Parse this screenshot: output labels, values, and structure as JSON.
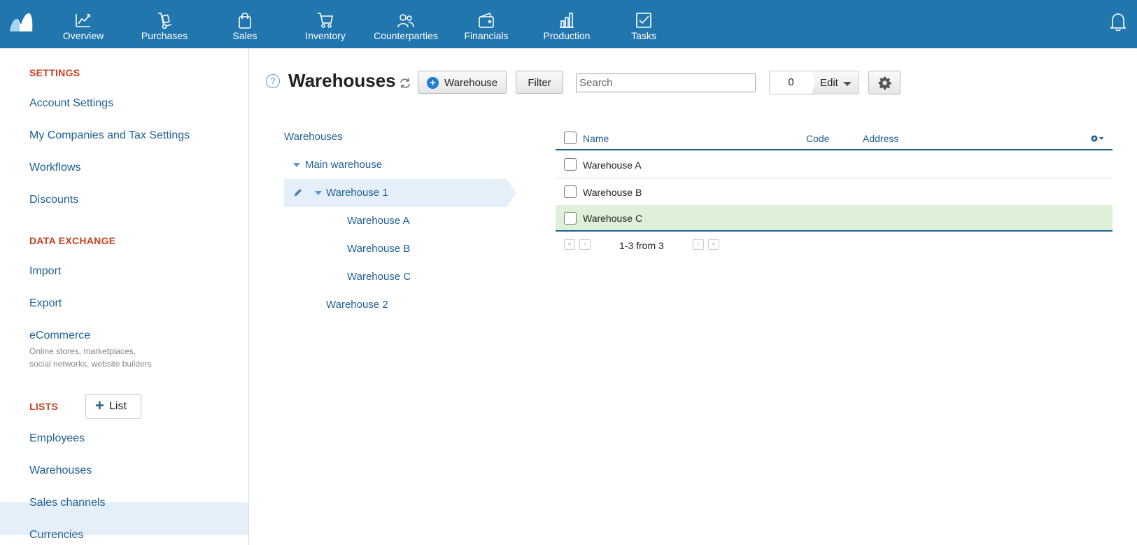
{
  "topnav": {
    "items": [
      {
        "label": "Overview",
        "icon": "chart-line-icon"
      },
      {
        "label": "Purchases",
        "icon": "hand-truck-icon"
      },
      {
        "label": "Sales",
        "icon": "shopping-bag-icon"
      },
      {
        "label": "Inventory",
        "icon": "cart-icon"
      },
      {
        "label": "Counterparties",
        "icon": "people-icon"
      },
      {
        "label": "Financials",
        "icon": "wallet-icon"
      },
      {
        "label": "Production",
        "icon": "factory-icon"
      },
      {
        "label": "Tasks",
        "icon": "checkbox-icon"
      }
    ],
    "bar_color": "#2176ae"
  },
  "sidebar": {
    "settings_title": "SETTINGS",
    "settings_items": [
      "Account Settings",
      "My Companies and Tax Settings",
      "Workflows",
      "Discounts"
    ],
    "data_exchange_title": "DATA EXCHANGE",
    "data_exchange_items": [
      "Import",
      "Export",
      "eCommerce"
    ],
    "ecommerce_sub1": "Online stores, marketplaces,",
    "ecommerce_sub2": "social networks, website builders",
    "lists_title": "LISTS",
    "list_button": "List",
    "lists_items": [
      "Employees",
      "Warehouses",
      "Sales channels",
      "Currencies"
    ],
    "active_item": "Warehouses",
    "section_color": "#c7401f"
  },
  "toolbar": {
    "help": "?",
    "title": "Warehouses",
    "add_button": "Warehouse",
    "filter_button": "Filter",
    "search_placeholder": "Search",
    "selected_count": "0",
    "edit_button": "Edit"
  },
  "tree": {
    "root": "Warehouses",
    "main": "Main warehouse",
    "selected": "Warehouse 1",
    "children": [
      "Warehouse A",
      "Warehouse B",
      "Warehouse C"
    ],
    "other": "Warehouse 2"
  },
  "grid": {
    "columns": [
      "Name",
      "Code",
      "Address"
    ],
    "rows": [
      {
        "name": "Warehouse A",
        "code": "",
        "address": ""
      },
      {
        "name": "Warehouse B",
        "code": "",
        "address": ""
      },
      {
        "name": "Warehouse C",
        "code": "",
        "address": ""
      }
    ],
    "highlighted_row": "Warehouse C",
    "pager_text": "1-3 from 3"
  }
}
